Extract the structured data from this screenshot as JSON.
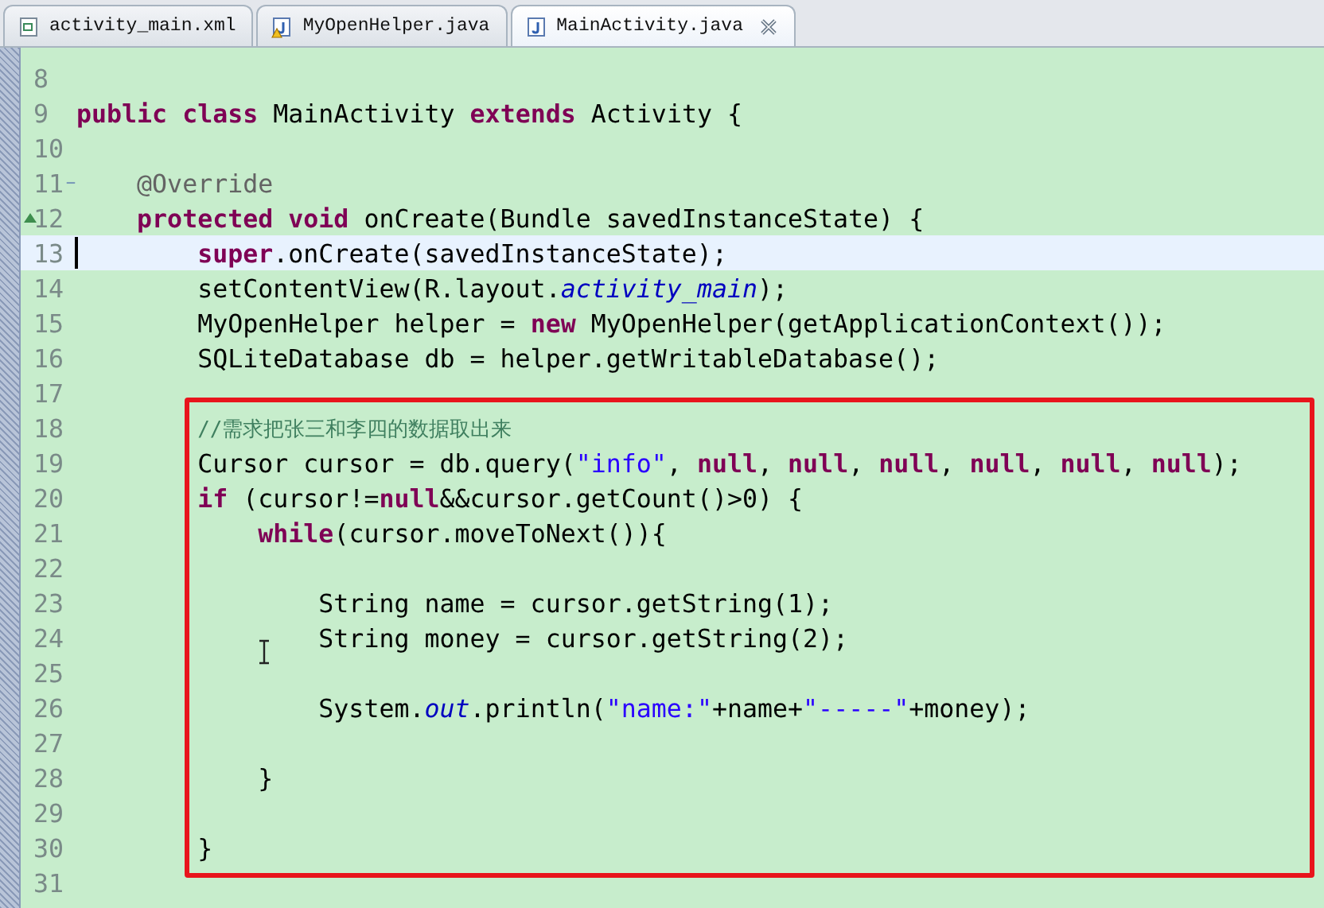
{
  "tabs": [
    {
      "label": "activity_main.xml",
      "kind": "xml",
      "selected": false
    },
    {
      "label": "MyOpenHelper.java",
      "kind": "java-warning",
      "selected": false
    },
    {
      "label": "MainActivity.java",
      "kind": "java",
      "selected": true
    }
  ],
  "editor": {
    "lines": [
      {
        "number": "8",
        "kind": "code",
        "current": false
      },
      {
        "number": "9",
        "kind": "code",
        "current": false,
        "tokens": [
          {
            "kind": "keyword",
            "text": "public class"
          },
          {
            "kind": "plain",
            "text": " MainActivity "
          },
          {
            "kind": "keyword",
            "text": "extends"
          },
          {
            "kind": "plain",
            "text": " Activity {"
          }
        ]
      },
      {
        "number": "10",
        "kind": "code",
        "current": false
      },
      {
        "number": "11",
        "kind": "fold",
        "current": false,
        "tokens": [
          {
            "kind": "annotation",
            "text": "    @Override"
          }
        ]
      },
      {
        "number": "12",
        "kind": "override",
        "current": false,
        "tokens": [
          {
            "kind": "keyword",
            "text": "    protected void"
          },
          {
            "kind": "plain",
            "text": " onCreate(Bundle savedInstanceState) {"
          }
        ]
      },
      {
        "number": "13",
        "kind": "code",
        "current": true,
        "tokens": [
          {
            "kind": "keyword",
            "text": "        super"
          },
          {
            "kind": "plain",
            "text": ".onCreate(savedInstanceState);"
          }
        ]
      },
      {
        "number": "14",
        "kind": "code",
        "current": false,
        "tokens": [
          {
            "kind": "plain",
            "text": "        setContentView(R.layout."
          },
          {
            "kind": "field",
            "text": "activity_main"
          },
          {
            "kind": "plain",
            "text": ");"
          }
        ]
      },
      {
        "number": "15",
        "kind": "code",
        "current": false,
        "tokens": [
          {
            "kind": "plain",
            "text": "        MyOpenHelper helper = "
          },
          {
            "kind": "keyword",
            "text": "new"
          },
          {
            "kind": "plain",
            "text": " MyOpenHelper(getApplicationContext());"
          }
        ]
      },
      {
        "number": "16",
        "kind": "code",
        "current": false,
        "tokens": [
          {
            "kind": "plain",
            "text": "        SQLiteDatabase db = helper.getWritableDatabase();"
          }
        ]
      },
      {
        "number": "17",
        "kind": "code",
        "current": false
      },
      {
        "number": "18",
        "kind": "code",
        "current": false,
        "tokens": [
          {
            "kind": "comment",
            "text": "        //需求把张三和李四的数据取出来"
          }
        ]
      },
      {
        "number": "19",
        "kind": "code",
        "current": false,
        "tokens": [
          {
            "kind": "plain",
            "text": "        Cursor cursor = db.query("
          },
          {
            "kind": "string",
            "text": "\"info\""
          },
          {
            "kind": "plain",
            "text": ", "
          },
          {
            "kind": "keyword",
            "text": "null"
          },
          {
            "kind": "plain",
            "text": ", "
          },
          {
            "kind": "keyword",
            "text": "null"
          },
          {
            "kind": "plain",
            "text": ", "
          },
          {
            "kind": "keyword",
            "text": "null"
          },
          {
            "kind": "plain",
            "text": ", "
          },
          {
            "kind": "keyword",
            "text": "null"
          },
          {
            "kind": "plain",
            "text": ", "
          },
          {
            "kind": "keyword",
            "text": "null"
          },
          {
            "kind": "plain",
            "text": ", "
          },
          {
            "kind": "keyword",
            "text": "null"
          },
          {
            "kind": "plain",
            "text": ");"
          }
        ]
      },
      {
        "number": "20",
        "kind": "code",
        "current": false,
        "tokens": [
          {
            "kind": "keyword",
            "text": "        if"
          },
          {
            "kind": "plain",
            "text": " (cursor!="
          },
          {
            "kind": "keyword",
            "text": "null"
          },
          {
            "kind": "plain",
            "text": "&&cursor.getCount()>0) {"
          }
        ]
      },
      {
        "number": "21",
        "kind": "code",
        "current": false,
        "tokens": [
          {
            "kind": "keyword",
            "text": "            while"
          },
          {
            "kind": "plain",
            "text": "(cursor.moveToNext()){"
          }
        ]
      },
      {
        "number": "22",
        "kind": "code",
        "current": false
      },
      {
        "number": "23",
        "kind": "code",
        "current": false,
        "tokens": [
          {
            "kind": "plain",
            "text": "                String name = cursor.getString(1);"
          }
        ]
      },
      {
        "number": "24",
        "kind": "code",
        "current": false,
        "tokens": [
          {
            "kind": "plain",
            "text": "                String money = cursor.getString(2);"
          }
        ]
      },
      {
        "number": "25",
        "kind": "code",
        "current": false
      },
      {
        "number": "26",
        "kind": "code",
        "current": false,
        "tokens": [
          {
            "kind": "plain",
            "text": "                System."
          },
          {
            "kind": "field",
            "text": "out"
          },
          {
            "kind": "plain",
            "text": ".println("
          },
          {
            "kind": "string",
            "text": "\"name:\""
          },
          {
            "kind": "plain",
            "text": "+name+"
          },
          {
            "kind": "string",
            "text": "\"-----\""
          },
          {
            "kind": "plain",
            "text": "+money);"
          }
        ]
      },
      {
        "number": "27",
        "kind": "code",
        "current": false
      },
      {
        "number": "28",
        "kind": "code",
        "current": false,
        "tokens": [
          {
            "kind": "plain",
            "text": "            }"
          }
        ]
      },
      {
        "number": "29",
        "kind": "code",
        "current": false
      },
      {
        "number": "30",
        "kind": "code",
        "current": false,
        "tokens": [
          {
            "kind": "plain",
            "text": "        }"
          }
        ]
      },
      {
        "number": "31",
        "kind": "code",
        "current": false
      }
    ]
  }
}
